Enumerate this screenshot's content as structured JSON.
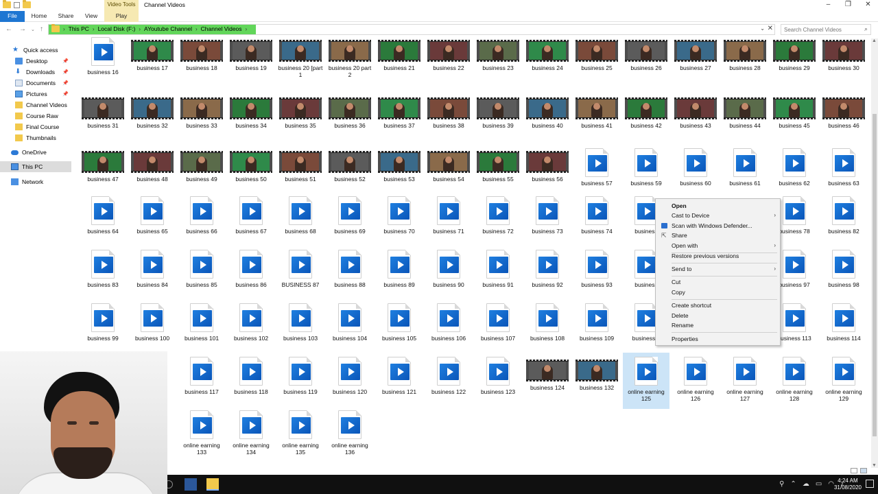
{
  "window": {
    "title": "Channel Videos",
    "context_tab_header": "Video Tools"
  },
  "ribbon": {
    "tabs": [
      "File",
      "Home",
      "Share",
      "View",
      "Play"
    ]
  },
  "address": {
    "crumbs": [
      "This PC",
      "Local Disk (F:)",
      "AYoutube Channel",
      "Channel Videos"
    ],
    "search_placeholder": "Search Channel Videos"
  },
  "sidebar": {
    "items": [
      {
        "label": "Quick access",
        "icon": "star-icon"
      },
      {
        "label": "Desktop",
        "icon": "desktop-icon",
        "pinned": true
      },
      {
        "label": "Downloads",
        "icon": "download-icon",
        "pinned": true
      },
      {
        "label": "Documents",
        "icon": "documents-icon",
        "pinned": true
      },
      {
        "label": "Pictures",
        "icon": "pictures-icon",
        "pinned": true
      },
      {
        "label": "Channel Videos",
        "icon": "folder-icon"
      },
      {
        "label": "Course Raw",
        "icon": "folder-icon"
      },
      {
        "label": "Final Course",
        "icon": "folder-icon"
      },
      {
        "label": "Thumbnails",
        "icon": "folder-icon"
      },
      {
        "label": "OneDrive",
        "icon": "cloud-icon"
      },
      {
        "label": "This PC",
        "icon": "computer-icon"
      },
      {
        "label": "Network",
        "icon": "network-icon"
      }
    ]
  },
  "files": {
    "rows": [
      [
        "business 16",
        "business 17",
        "business 18",
        "business 19",
        "business 20 [part 1",
        "business 20 part 2",
        "business 21",
        "business 22",
        "business 23",
        "business 24",
        "business 25",
        "business 26",
        "business 27",
        "business 28",
        "business 29",
        "business 30"
      ],
      [
        "business 31",
        "business 32",
        "business 33",
        "business 34",
        "business 35",
        "business 36",
        "business 37",
        "business 38",
        "business 39",
        "business 40",
        "business 41",
        "business 42",
        "business 43",
        "business 44",
        "business 45",
        "business 46"
      ],
      [
        "business 47",
        "business 48",
        "business 49",
        "business 50",
        "business 51",
        "business 52",
        "business 53",
        "business 54",
        "business 55",
        "business 56",
        "business 57",
        "business 59",
        "business 60",
        "business 61",
        "business 62",
        "business 63"
      ],
      [
        "business 64",
        "business 65",
        "business 66",
        "business 67",
        "business 68",
        "business 69",
        "business 70",
        "business 71",
        "business 72",
        "business 73",
        "business 74",
        "business",
        "",
        "",
        "business 78",
        "business 82"
      ],
      [
        "business 83",
        "business 84",
        "business 85",
        "business 86",
        "BUSINESS 87",
        "business 88",
        "business 89",
        "business 90",
        "business 91",
        "business 92",
        "business 93",
        "business",
        "",
        "",
        "business 97",
        "business 98"
      ],
      [
        "business 99",
        "business 100",
        "business 101",
        "business 102",
        "business 103",
        "business 104",
        "business 105",
        "business 106",
        "business 107",
        "business 108",
        "business 109",
        "business 1",
        "",
        "",
        "business 113",
        "business 114"
      ],
      [
        "",
        "6",
        "business 117",
        "business 118",
        "business 119",
        "business 120",
        "business 121",
        "business 122",
        "business 123",
        "business 124",
        "business 132",
        "online earning 125",
        "online earning 126",
        "online earning 127",
        "online earning 128",
        "online earning 129"
      ],
      [
        "",
        "g",
        "online earning 133",
        "online earning 134",
        "online earning 135",
        "online earning 136"
      ]
    ]
  },
  "context_menu": {
    "items": [
      {
        "label": "Open",
        "bold": true
      },
      {
        "label": "Cast to Device",
        "submenu": true
      },
      {
        "label": "Scan with Windows Defender...",
        "icon": "defender-icon"
      },
      {
        "label": "Share",
        "icon": "share-icon"
      },
      {
        "label": "Open with",
        "submenu": true
      },
      {
        "label": "Restore previous versions"
      },
      {
        "label": "Send to",
        "submenu": true
      },
      {
        "label": "Cut"
      },
      {
        "label": "Copy"
      },
      {
        "label": "Create shortcut"
      },
      {
        "label": "Delete"
      },
      {
        "label": "Rename"
      },
      {
        "label": "Properties"
      }
    ]
  },
  "taskbar": {
    "time": "4:24 AM",
    "date": "31/08/2020"
  },
  "colors": {
    "accent": "#1e76d2",
    "progress": "#62d65a",
    "video_tools": "#f6e9b2",
    "selection": "#cce4f7"
  }
}
